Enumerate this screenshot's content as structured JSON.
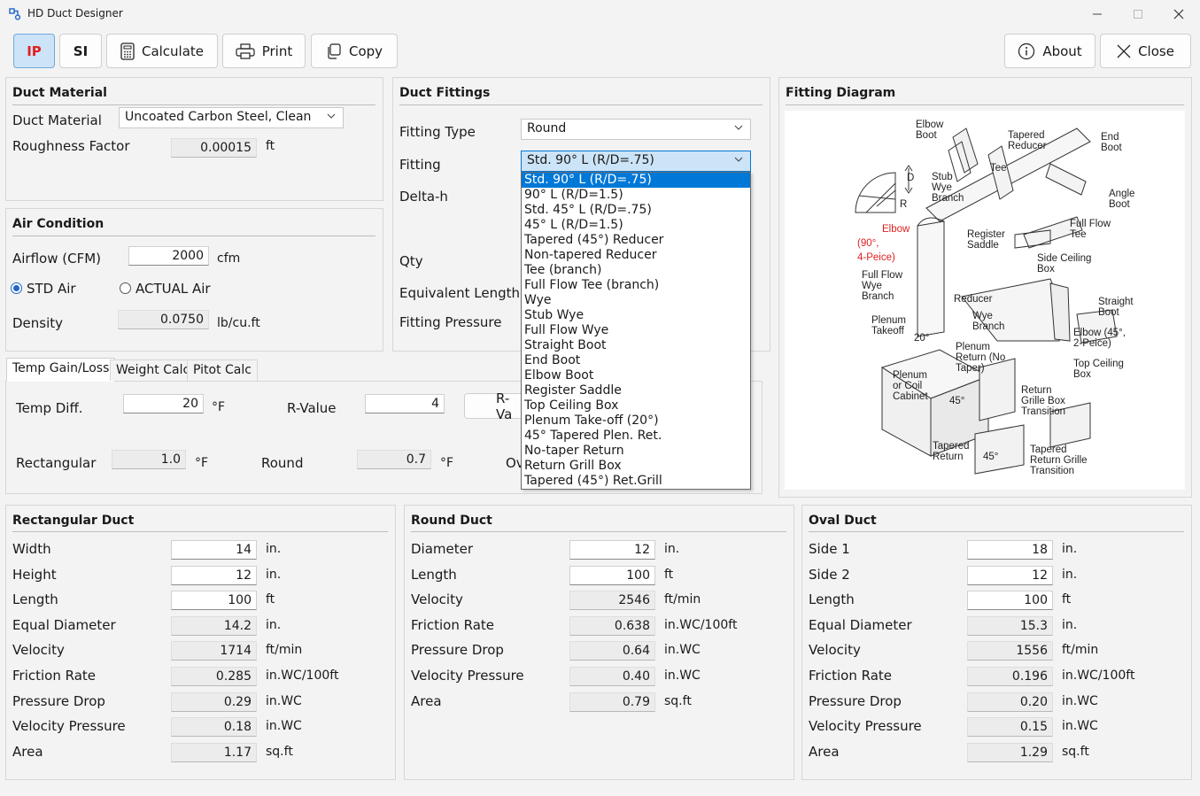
{
  "window": {
    "title": "HD Duct Designer",
    "controls": {
      "minimize": "minimize-icon",
      "maximize": "maximize-icon",
      "close": "close-icon"
    }
  },
  "toolbar": {
    "ip_label": "IP",
    "si_label": "SI",
    "calculate_label": "Calculate",
    "print_label": "Print",
    "copy_label": "Copy",
    "about_label": "About",
    "close_label": "Close"
  },
  "duct_material": {
    "title": "Duct Material",
    "material_label": "Duct Material",
    "material_value": "Uncoated Carbon Steel, Clean",
    "roughness_label": "Roughness Factor",
    "roughness_value": "0.00015",
    "roughness_unit": "ft"
  },
  "air_condition": {
    "title": "Air Condition",
    "airflow_label": "Airflow (CFM)",
    "airflow_value": "2000",
    "airflow_unit": "cfm",
    "std_air_label": "STD Air",
    "actual_air_label": "ACTUAL Air",
    "selected": "STD Air",
    "density_label": "Density",
    "density_value": "0.0750",
    "density_unit": "lb/cu.ft"
  },
  "duct_fittings": {
    "title": "Duct Fittings",
    "fitting_type_label": "Fitting Type",
    "fitting_type_value": "Round",
    "fitting_label": "Fitting",
    "fitting_value": "Std. 90° L (R/D=.75)",
    "delta_h_label": "Delta-h",
    "qty_label": "Qty",
    "equivalent_length_label": "Equivalent Length",
    "fitting_pressure_label": "Fitting Pressure",
    "options": [
      "Std. 90° L (R/D=.75)",
      "90° L (R/D=1.5)",
      "Std. 45° L (R/D=.75)",
      "45° L (R/D=1.5)",
      "Tapered (45°) Reducer",
      "Non-tapered Reducer",
      "Tee (branch)",
      "Full Flow Tee (branch)",
      "Wye",
      "Stub Wye",
      "Full Flow Wye",
      "Straight Boot",
      "End Boot",
      "Elbow Boot",
      "Register Saddle",
      "Top Ceiling Box",
      "Plenum Take-off (20°)",
      "45° Tapered Plen. Ret.",
      "No-taper Return",
      "Return Grill Box",
      "Tapered (45°) Ret.Grill"
    ]
  },
  "fitting_diagram": {
    "title": "Fitting Diagram",
    "labels": {
      "elbow_boot": [
        "Elbow",
        "Boot"
      ],
      "tapered_reducer": [
        "Tapered",
        "Reducer"
      ],
      "end_boot": [
        "End",
        "Boot"
      ],
      "tee": "Tee",
      "stub_wye": [
        "Stub",
        "Wye",
        "Branch"
      ],
      "angle_boot": [
        "Angle",
        "Boot"
      ],
      "elbow_red": [
        "Elbow",
        "(90°,",
        "4-Peice)"
      ],
      "full_flow_tee": [
        "Full Flow",
        "Tee"
      ],
      "register_saddle": [
        "Register",
        "Saddle"
      ],
      "side_ceiling_box": [
        "Side Ceiling",
        "Box"
      ],
      "full_flow_wye": [
        "Full Flow",
        "Wye",
        "Branch"
      ],
      "reducer": "Reducer",
      "straight_boot": [
        "Straight",
        "Boot"
      ],
      "wye_branch": [
        "Wye",
        "Branch"
      ],
      "plenum_takeoff": [
        "Plenum",
        "Takeoff"
      ],
      "elbow_45": [
        "Elbow (45°,",
        "2-Peice)"
      ],
      "plenum_return": [
        "Plenum",
        "Return (No",
        "Taper)"
      ],
      "top_ceiling_box": [
        "Top Ceiling",
        "Box"
      ],
      "plenum_coil": [
        "Plenum",
        "or Coil",
        "Cabinet"
      ],
      "return_grille_box": [
        "Return",
        "Grille Box",
        "Transition"
      ],
      "tapered_return": [
        "Tapered",
        "Return"
      ],
      "tapered_return_grille": [
        "Tapered",
        "Return Grille",
        "Transition"
      ],
      "angle_20": "20°",
      "angle_45a": "45°",
      "angle_45b": "45°",
      "dim_d": "D",
      "dim_r": "R"
    }
  },
  "tabs": {
    "items": [
      "Temp Gain/Loss",
      "Weight Calc",
      "Pitot Calc"
    ],
    "active": "Temp Gain/Loss"
  },
  "temp_gain": {
    "temp_diff_label": "Temp Diff.",
    "temp_diff_value": "20",
    "temp_unit": "°F",
    "r_value_label": "R-Value",
    "r_value_value": "4",
    "r_value_button": "R-Va",
    "rectangular_label": "Rectangular",
    "rectangular_value": "1.0",
    "rectangular_unit": "°F",
    "round_label": "Round",
    "round_value": "0.7",
    "round_unit": "°F",
    "oval_partial": "Ov"
  },
  "rectangular_duct": {
    "title": "Rectangular Duct",
    "rows": [
      {
        "label": "Width",
        "value": "14",
        "unit": "in.",
        "editable": true
      },
      {
        "label": "Height",
        "value": "12",
        "unit": "in.",
        "editable": true
      },
      {
        "label": "Length",
        "value": "100",
        "unit": "ft",
        "editable": true
      },
      {
        "label": "Equal Diameter",
        "value": "14.2",
        "unit": "in.",
        "editable": false
      },
      {
        "label": "Velocity",
        "value": "1714",
        "unit": "ft/min",
        "editable": false
      },
      {
        "label": "Friction Rate",
        "value": "0.285",
        "unit": "in.WC/100ft",
        "editable": false
      },
      {
        "label": "Pressure Drop",
        "value": "0.29",
        "unit": "in.WC",
        "editable": false
      },
      {
        "label": "Velocity Pressure",
        "value": "0.18",
        "unit": "in.WC",
        "editable": false
      },
      {
        "label": "Area",
        "value": "1.17",
        "unit": "sq.ft",
        "editable": false
      }
    ]
  },
  "round_duct": {
    "title": "Round Duct",
    "rows": [
      {
        "label": "Diameter",
        "value": "12",
        "unit": "in.",
        "editable": true
      },
      {
        "label": "Length",
        "value": "100",
        "unit": "ft",
        "editable": true
      },
      {
        "label": "Velocity",
        "value": "2546",
        "unit": "ft/min",
        "editable": false
      },
      {
        "label": "Friction Rate",
        "value": "0.638",
        "unit": "in.WC/100ft",
        "editable": false
      },
      {
        "label": "Pressure Drop",
        "value": "0.64",
        "unit": "in.WC",
        "editable": false
      },
      {
        "label": "Velocity Pressure",
        "value": "0.40",
        "unit": "in.WC",
        "editable": false
      },
      {
        "label": "Area",
        "value": "0.79",
        "unit": "sq.ft",
        "editable": false
      }
    ]
  },
  "oval_duct": {
    "title": "Oval Duct",
    "rows": [
      {
        "label": "Side 1",
        "value": "18",
        "unit": "in.",
        "editable": true
      },
      {
        "label": "Side 2",
        "value": "12",
        "unit": "in.",
        "editable": true
      },
      {
        "label": "Length",
        "value": "100",
        "unit": "ft",
        "editable": true
      },
      {
        "label": "Equal Diameter",
        "value": "15.3",
        "unit": "in.",
        "editable": false
      },
      {
        "label": "Velocity",
        "value": "1556",
        "unit": "ft/min",
        "editable": false
      },
      {
        "label": "Friction Rate",
        "value": "0.196",
        "unit": "in.WC/100ft",
        "editable": false
      },
      {
        "label": "Pressure Drop",
        "value": "0.20",
        "unit": "in.WC",
        "editable": false
      },
      {
        "label": "Velocity Pressure",
        "value": "0.15",
        "unit": "in.WC",
        "editable": false
      },
      {
        "label": "Area",
        "value": "1.29",
        "unit": "sq.ft",
        "editable": false
      }
    ]
  },
  "colors": {
    "window_bg": "#f3f3f3",
    "accent": "#0078d7",
    "ip_active_bg": "#cde3f7",
    "ip_text": "#e02020",
    "diagram_red": "#e02020"
  }
}
